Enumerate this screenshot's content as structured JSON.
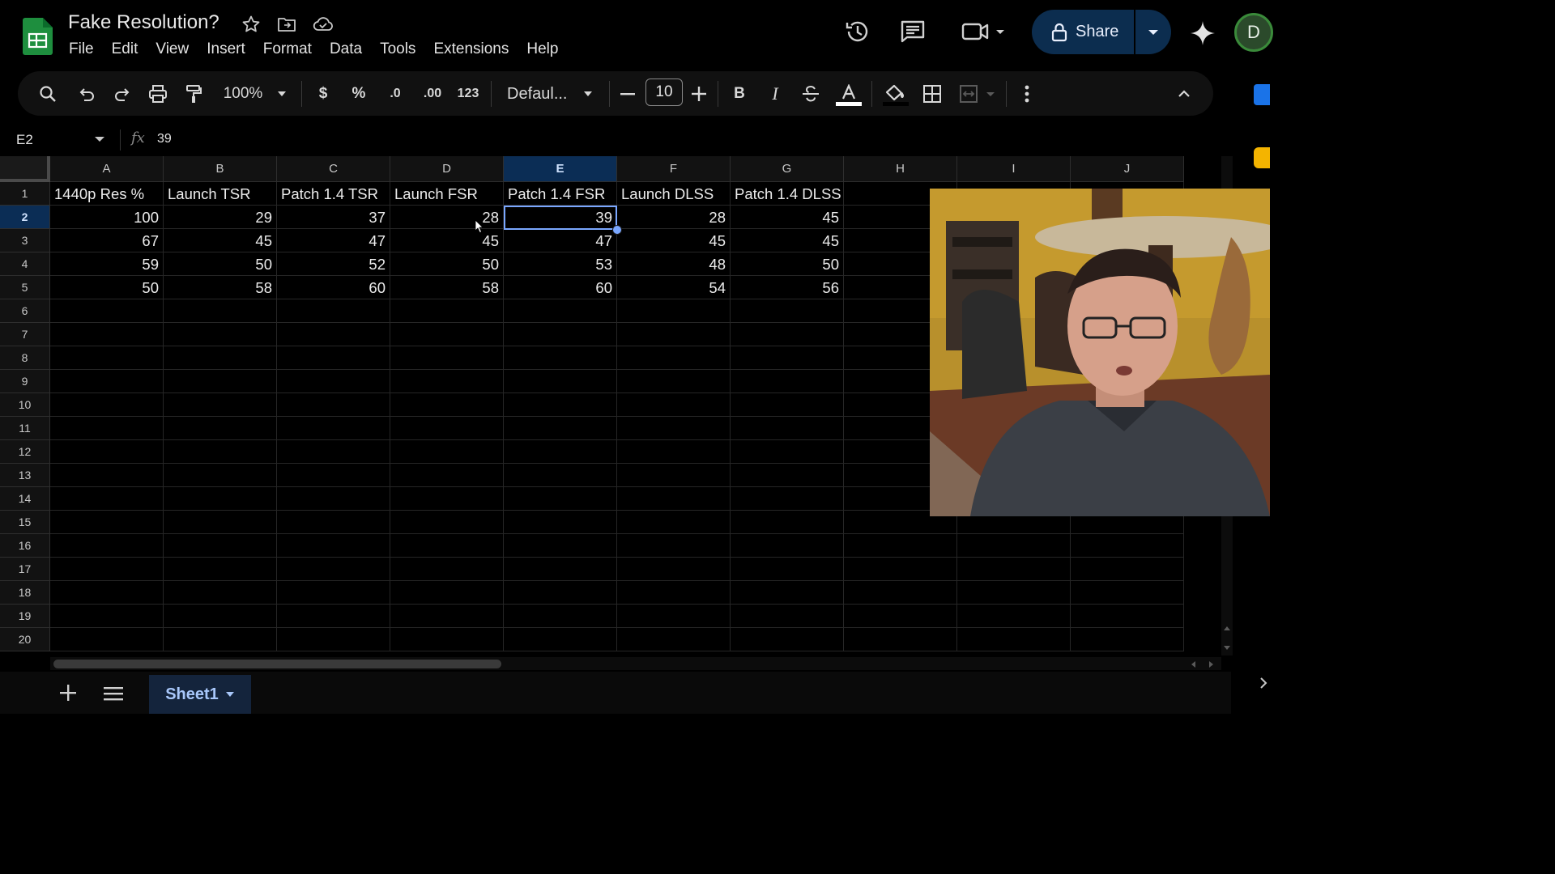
{
  "app": {
    "title": "Fake Resolution?",
    "menu": [
      "File",
      "Edit",
      "View",
      "Insert",
      "Format",
      "Data",
      "Tools",
      "Extensions",
      "Help"
    ],
    "share_label": "Share",
    "avatar_letter": "D"
  },
  "toolbar": {
    "zoom": "100%",
    "currency": "$",
    "percent": "%",
    "decrease_decimal": ".0",
    "increase_decimal": ".00",
    "number_format": "123",
    "font": "Defaul...",
    "font_size": "10",
    "bold": "B",
    "italic": "I"
  },
  "formula_bar": {
    "name_box": "E2",
    "fx": "fx",
    "value": "39"
  },
  "sheet": {
    "columns": [
      "A",
      "B",
      "C",
      "D",
      "E",
      "F",
      "G",
      "H",
      "I",
      "J"
    ],
    "rows": [
      "1",
      "2",
      "3",
      "4",
      "5",
      "6",
      "7",
      "8",
      "9",
      "10",
      "11",
      "12",
      "13",
      "14",
      "15",
      "16",
      "17",
      "18",
      "19",
      "20"
    ],
    "selected_column": "E",
    "selected_row": "2",
    "headers": [
      "1440p Res %",
      "Launch TSR",
      "Patch 1.4 TSR",
      "Launch FSR",
      "Patch 1.4 FSR",
      "Launch DLSS",
      "Patch 1.4 DLSS"
    ],
    "data": [
      [
        "100",
        "29",
        "37",
        "28",
        "39",
        "28",
        "45"
      ],
      [
        "67",
        "45",
        "47",
        "45",
        "47",
        "45",
        "45"
      ],
      [
        "59",
        "50",
        "52",
        "50",
        "53",
        "48",
        "50"
      ],
      [
        "50",
        "58",
        "60",
        "58",
        "60",
        "54",
        "56"
      ]
    ]
  },
  "bottom": {
    "sheet_tab": "Sheet1"
  },
  "colors": {
    "selection": "#7aa7ff",
    "share_bg": "#0c2d4f",
    "sheets_green": "#1e8e3e"
  }
}
